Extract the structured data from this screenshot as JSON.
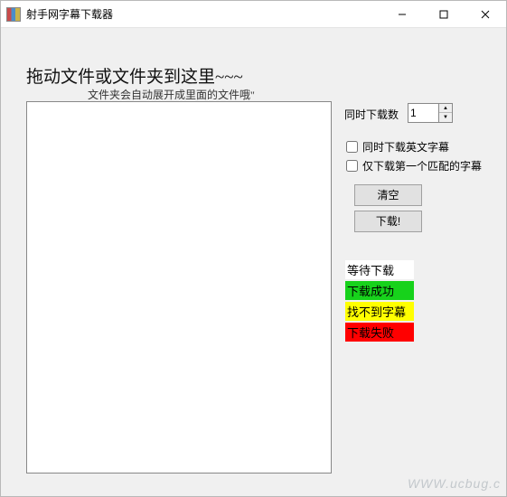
{
  "window": {
    "title": "射手网字幕下载器"
  },
  "dropzone": {
    "title": "拖动文件或文件夹到这里~~~",
    "subtitle": "文件夹会自动展开成里面的文件哦\""
  },
  "controls": {
    "concurrent_label": "同时下载数",
    "concurrent_value": "1",
    "checkbox_english": "同时下载英文字幕",
    "checkbox_firstmatch": "仅下载第一个匹配的字幕",
    "btn_clear": "清空",
    "btn_download": "下载!"
  },
  "legend": {
    "waiting": "等待下载",
    "success": "下载成功",
    "not_found": "找不到字幕",
    "failed": "下载失败"
  },
  "watermark": "WWW.ucbug.c",
  "colors": {
    "success": "#17d21b",
    "not_found": "#ffff00",
    "failed": "#ff0000"
  }
}
